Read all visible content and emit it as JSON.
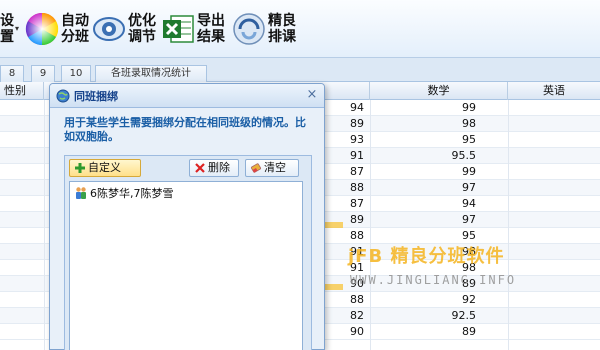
{
  "toolbar": {
    "partial_left_top": "设",
    "partial_left_bottom": "置",
    "auto_label": "自动\n分班",
    "optimize_label": "优化\n调节",
    "export_label": "导出\n结果",
    "fine_label": "精良\n排课"
  },
  "tabs": [
    "8",
    "9",
    "10",
    "各班录取情况统计"
  ],
  "grid": {
    "headers": {
      "gender": "性别",
      "math": "数学",
      "english": "英语"
    },
    "rows": [
      {
        "c": "94",
        "math": "99"
      },
      {
        "c": "89",
        "math": "98"
      },
      {
        "c": "93",
        "math": "95"
      },
      {
        "c": "91",
        "math": "95.5"
      },
      {
        "c": "87",
        "math": "99"
      },
      {
        "c": "88",
        "math": "97"
      },
      {
        "c": "87",
        "math": "94"
      },
      {
        "c": "89",
        "math": "97"
      },
      {
        "c": "88",
        "math": "95"
      },
      {
        "c": "91",
        "math": "98"
      },
      {
        "c": "91",
        "math": "98"
      },
      {
        "c": "90",
        "math": "89"
      },
      {
        "c": "88",
        "math": "92"
      },
      {
        "c": "82",
        "math": "92.5"
      },
      {
        "c": "90",
        "math": "89"
      }
    ]
  },
  "dialog": {
    "title": "同班捆绑",
    "close": "×",
    "description": "用于某些学生需要捆绑分配在相同班级的情况。比如双胞胎。",
    "buttons": {
      "custom": "自定义",
      "delete": "删除",
      "clear": "清空"
    },
    "items": [
      "6陈梦华,7陈梦雪"
    ]
  },
  "watermark": {
    "main": "jFB 精良分班软件",
    "sub": "WWW.JINGLIANG.INFO"
  },
  "colors": {
    "accent": "#15428b",
    "desc_text": "#1b5fa6",
    "watermark": "#f4b41e"
  }
}
